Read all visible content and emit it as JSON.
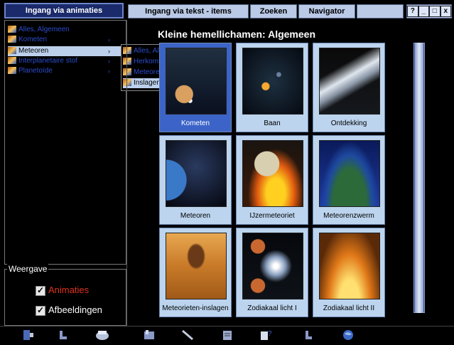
{
  "left_tab": {
    "label": "Ingang via animaties"
  },
  "top_tabs": {
    "text_entry": "Ingang via tekst - items",
    "search": "Zoeken",
    "navigator": "Navigator",
    "blank": ""
  },
  "window_controls": {
    "help": "?",
    "minimize": "_",
    "restore": "□",
    "close": "x"
  },
  "tree": {
    "items": [
      {
        "label": "Alles, Algemeen",
        "has_arrow": false
      },
      {
        "label": "Kometen",
        "has_arrow": true
      },
      {
        "label": "Meteoren",
        "has_arrow": true
      },
      {
        "label": "Interplanetaire stof",
        "has_arrow": true
      },
      {
        "label": "Planetoïde",
        "has_arrow": true
      }
    ],
    "selected_index": 2
  },
  "submenu": {
    "items": [
      {
        "label": "Alles, Algemeen"
      },
      {
        "label": "Herkomst van meteoren"
      },
      {
        "label": "Meteorenzwermen"
      },
      {
        "label": "Inslagen"
      }
    ],
    "selected_index": 3
  },
  "view": {
    "title": "Weergave",
    "animations_label": "Animaties",
    "images_label": "Afbeeldingen",
    "animations_checked": true,
    "images_checked": true,
    "animations_color": "#e0321e",
    "images_color": "#ffffff"
  },
  "main": {
    "title": "Kleine hemellichamen: Algemeen",
    "tiles": [
      {
        "caption": "Kometen",
        "selected": true
      },
      {
        "caption": "Baan",
        "selected": false
      },
      {
        "caption": "Ontdekking",
        "selected": false
      },
      {
        "caption": "Meteoren",
        "selected": false
      },
      {
        "caption": "IJzermeteoriet",
        "selected": false
      },
      {
        "caption": "Meteorenzwerm",
        "selected": false
      },
      {
        "caption": "Meteorieten-inslagen",
        "selected": false
      },
      {
        "caption": "Zodiakaal licht I",
        "selected": false
      },
      {
        "caption": "Zodiakaal licht II",
        "selected": false
      }
    ]
  },
  "colors": {
    "tile_bg": "#bcd4ee",
    "tile_selected": "#3c64c8",
    "menu_text": "#2c4ccc",
    "highlight": "#bcd0ec"
  },
  "bottom_icons": [
    "exit-icon",
    "back-icon",
    "print-icon",
    "bookmark-icon",
    "tools-icon",
    "notes-icon",
    "help-book-icon",
    "pointer-icon",
    "globe-icon"
  ]
}
